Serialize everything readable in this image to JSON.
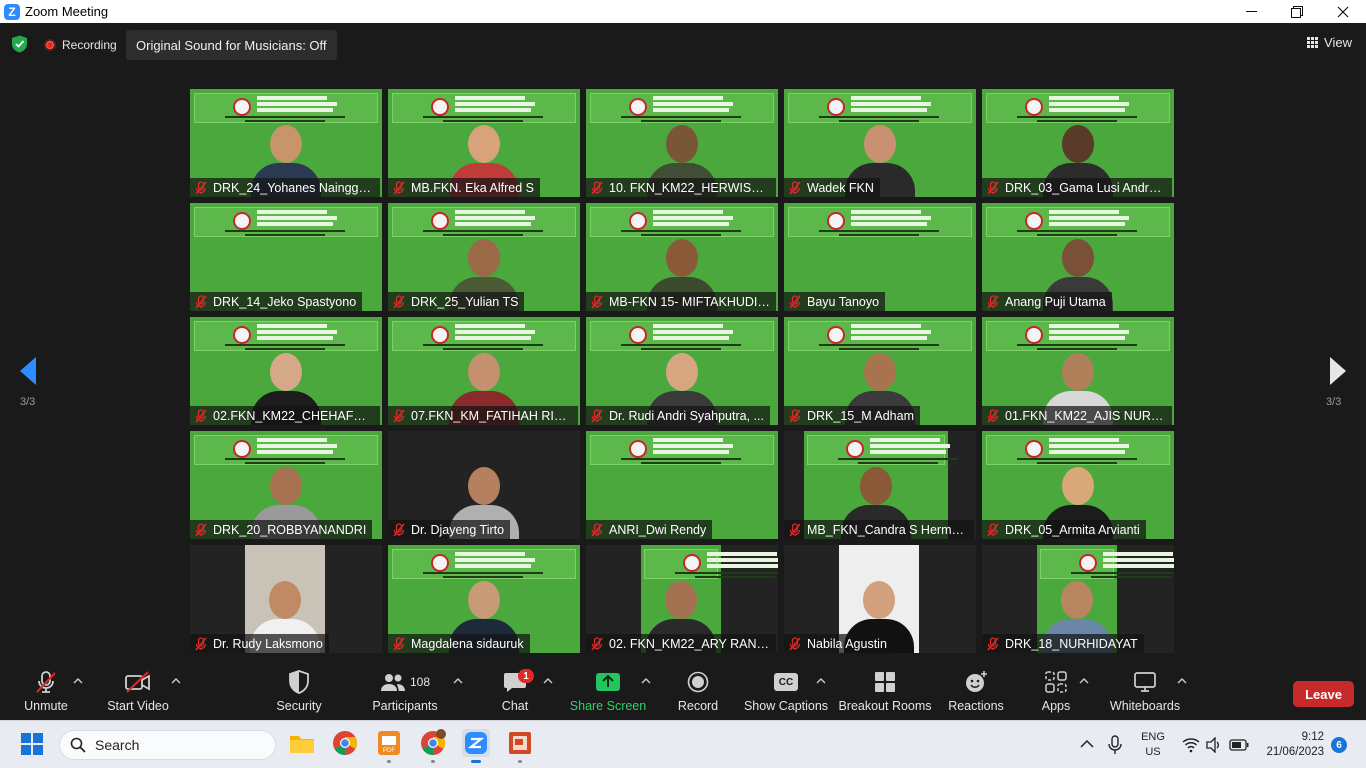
{
  "window": {
    "title": "Zoom Meeting",
    "minimize": "—",
    "maximize": "❐",
    "close": "✕"
  },
  "topbar": {
    "recording_label": "Recording",
    "original_sound_label": "Original Sound for Musicians: Off",
    "view_label": "View"
  },
  "pagination": {
    "left_label": "3/3",
    "right_label": "3/3"
  },
  "participants_tiles": [
    {
      "name": "DRK_24_Yohanes Nainggol..."
    },
    {
      "name": "MB.FKN. Eka Alfred S"
    },
    {
      "name": "10. FKN_KM22_HERWIST SI..."
    },
    {
      "name": "Wadek FKN"
    },
    {
      "name": "DRK_03_Gama Lusi Andrea..."
    },
    {
      "name": "DRK_14_Jeko Spastyono"
    },
    {
      "name": "DRK_25_Yulian TS"
    },
    {
      "name": "MB-FKN 15- MIFTAKHUDIN..."
    },
    {
      "name": "Bayu Tanoyo"
    },
    {
      "name": "Anang Puji Utama"
    },
    {
      "name": "02.FKN_KM22_CHEHAFNI D..."
    },
    {
      "name": "07.FKN_KM_FATIHAH RIZKI..."
    },
    {
      "name": "Dr. Rudi Andri Syahputra, ..."
    },
    {
      "name": "DRK_15_M Adham"
    },
    {
      "name": "01.FKN_KM22_AJIS NUR EF..."
    },
    {
      "name": "DRK_20_ROBBYANANDRI"
    },
    {
      "name": "Dr. Djayeng Tirto"
    },
    {
      "name": "ANRI_Dwi Rendy"
    },
    {
      "name": "MB_FKN_Candra S Hermaw..."
    },
    {
      "name": "DRK_05_Armita Arvianti"
    },
    {
      "name": "Dr. Rudy Laksmono"
    },
    {
      "name": "Magdalena sidauruk"
    },
    {
      "name": "02. FKN_KM22_ARY RANDY"
    },
    {
      "name": "Nabila Agustin"
    },
    {
      "name": "DRK_18_NURHIDAYAT"
    }
  ],
  "toolbar": {
    "unmute_label": "Unmute",
    "start_video_label": "Start Video",
    "security_label": "Security",
    "participants_label": "Participants",
    "participants_count": "108",
    "chat_label": "Chat",
    "chat_badge": "1",
    "share_screen_label": "Share Screen",
    "record_label": "Record",
    "show_captions_label": "Show Captions",
    "cc_icon_text": "CC",
    "breakout_rooms_label": "Breakout Rooms",
    "reactions_label": "Reactions",
    "apps_label": "Apps",
    "whiteboards_label": "Whiteboards",
    "leave_label": "Leave"
  },
  "taskbar": {
    "search_placeholder": "Search",
    "lang_line1": "ENG",
    "lang_line2": "US",
    "time": "9:12",
    "date": "21/06/2023",
    "notification_count": "6"
  },
  "colors": {
    "zoom_blue": "#2d8cff",
    "leave_red": "#c72a2a",
    "share_green": "#22c55e",
    "banner_green": "#4aa83c",
    "toolbar_bg": "#1a1a1a"
  }
}
